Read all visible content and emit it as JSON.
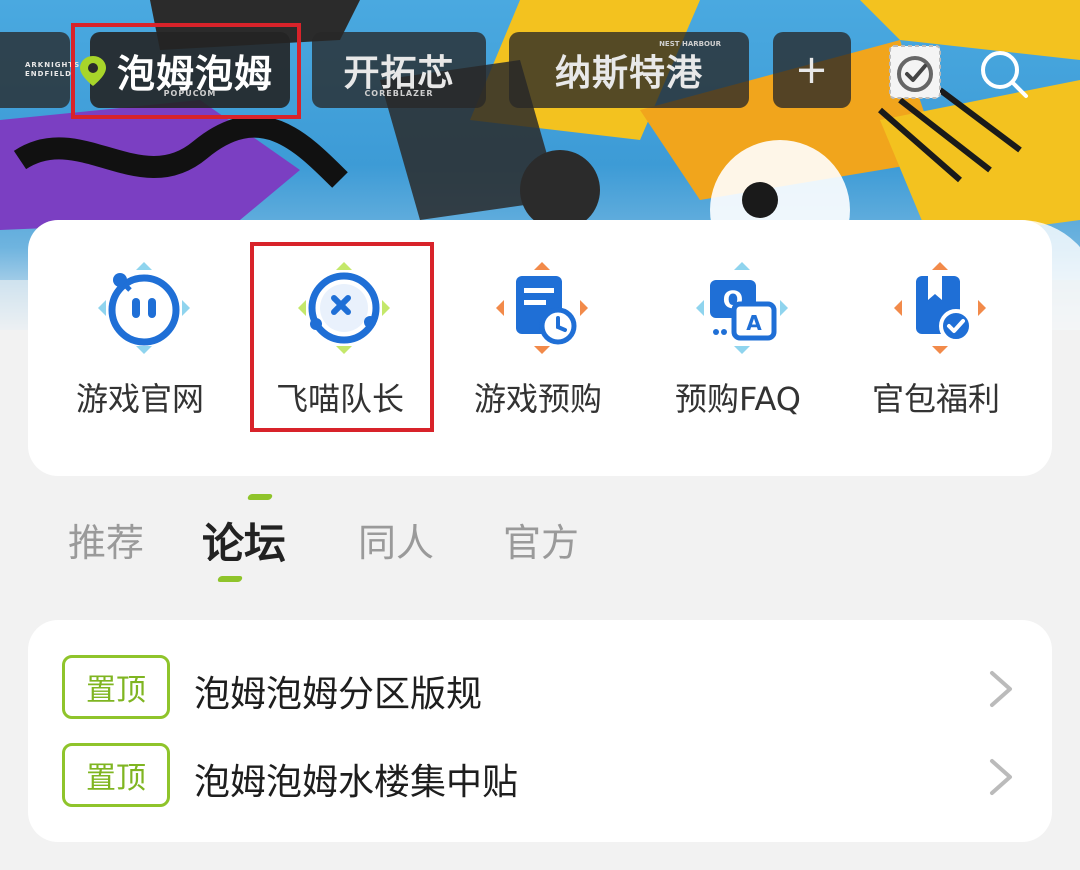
{
  "top_tabs": [
    {
      "caption": "ARKNIGHTS ENDFIELD",
      "sub": ""
    },
    {
      "caption": "泡姆泡姆",
      "sub": "POPUCOM"
    },
    {
      "caption": "开拓芯",
      "sub": "COREBLAZER"
    },
    {
      "caption": "纳斯特港",
      "sub": "",
      "sup": "NEST HARBOUR"
    },
    {
      "caption": "+"
    }
  ],
  "shortcuts": [
    {
      "label": "游戏官网",
      "icon": "official-site-icon"
    },
    {
      "label": "飞喵队长",
      "icon": "feimiao-captain-icon"
    },
    {
      "label": "游戏预购",
      "icon": "preorder-icon"
    },
    {
      "label": "预购FAQ",
      "icon": "faq-icon"
    },
    {
      "label": "官包福利",
      "icon": "benefits-icon"
    }
  ],
  "forum_tabs": [
    {
      "label": "推荐"
    },
    {
      "label": "论坛",
      "active": true
    },
    {
      "label": "同人"
    },
    {
      "label": "官方"
    }
  ],
  "pinned": {
    "badge": "置顶",
    "items": [
      {
        "title": "泡姆泡姆分区版规"
      },
      {
        "title": "泡姆泡姆水楼集中贴"
      }
    ]
  },
  "colors": {
    "accent_green": "#8fc42b",
    "icon_blue": "#1f6fd6",
    "highlight_red": "#d8232a"
  }
}
